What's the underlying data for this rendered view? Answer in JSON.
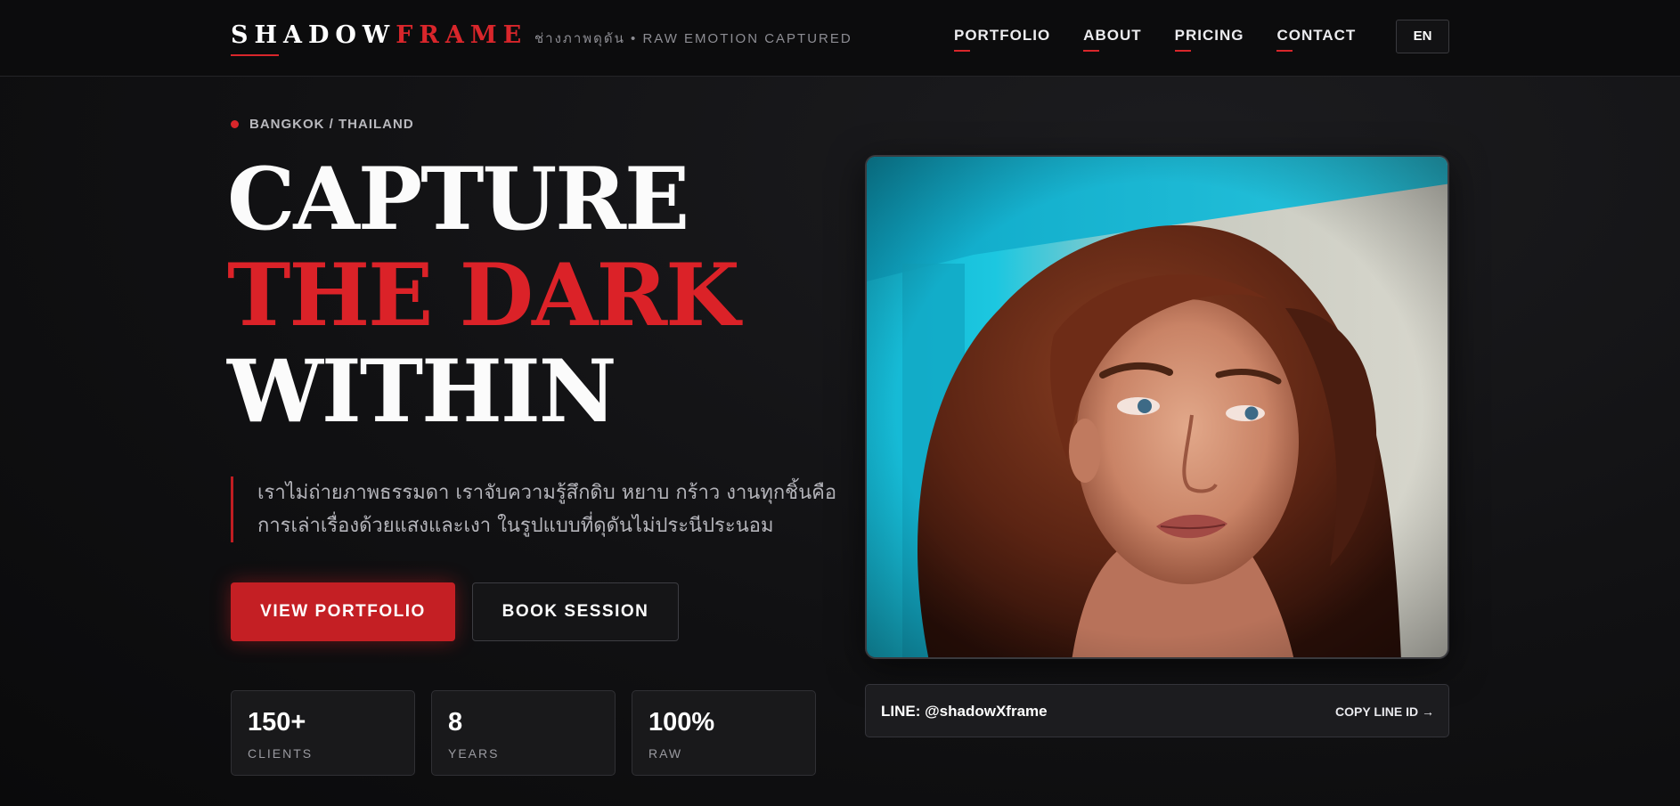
{
  "header": {
    "brand_part1": "SHADOW",
    "brand_part2": "FRAME",
    "tagline": "ช่างภาพดุดัน • RAW EMOTION CAPTURED",
    "nav": [
      "PORTFOLIO",
      "ABOUT",
      "PRICING",
      "CONTACT"
    ],
    "lang": "EN"
  },
  "hero": {
    "location": "BANGKOK / THAILAND",
    "headline": [
      "CAPTURE",
      "THE DARK",
      "WITHIN"
    ],
    "intro": [
      "เราไม่ถ่ายภาพธรรมดา เราจับความรู้สึกดิบ หยาบ กร้าว งานทุกชิ้นคือ",
      "การเล่าเรื่องด้วยแสงและเงา ในรูปแบบที่ดุดันไม่ประนีประนอม"
    ],
    "primary_button": "VIEW PORTFOLIO",
    "secondary_button": "BOOK SESSION",
    "stats": [
      {
        "value": "150+",
        "label": "CLIENTS"
      },
      {
        "value": "8",
        "label": "YEARS"
      },
      {
        "value": "100%",
        "label": "RAW"
      }
    ]
  },
  "contact": {
    "line_id": "LINE: @shadowXframe",
    "copy_label": "COPY LINE ID →"
  },
  "colors": {
    "accent": "#d9262b",
    "background": "#111113",
    "photo_backdrop": "#19c2dc"
  }
}
